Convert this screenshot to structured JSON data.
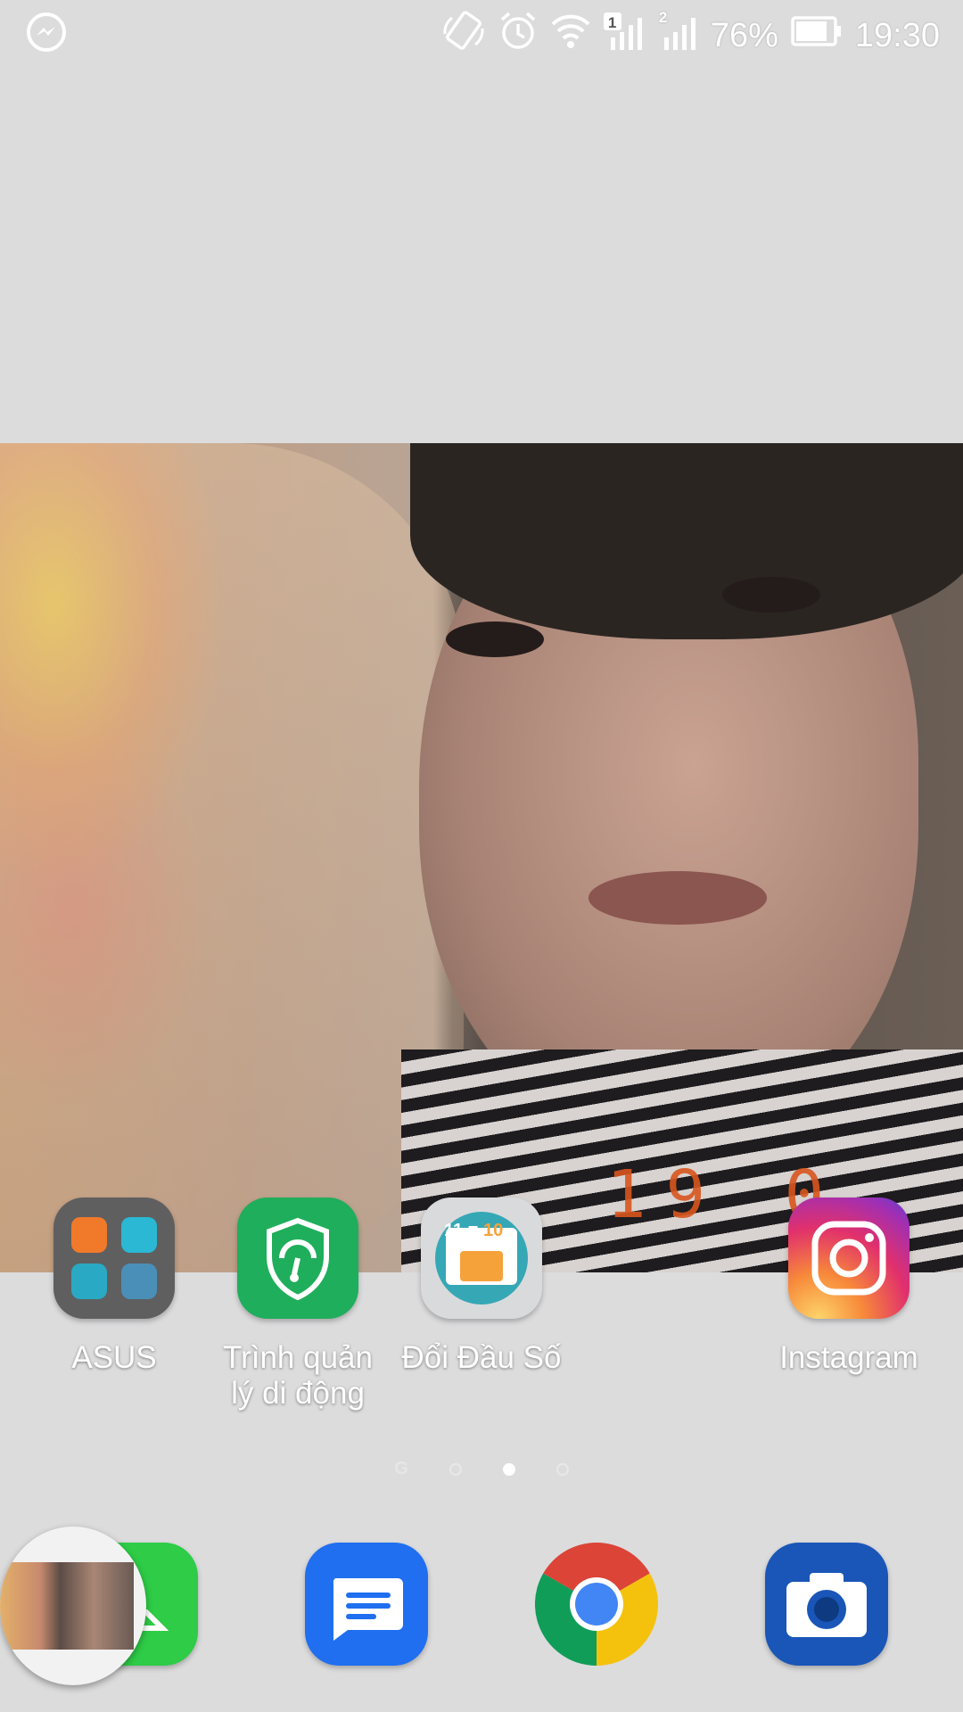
{
  "status_bar": {
    "left_icons": [
      "messenger-icon"
    ],
    "right_icons": [
      "auto-rotate-icon",
      "alarm-icon",
      "wifi-icon",
      "sim1-signal-icon",
      "sim2-signal-icon",
      "battery-icon"
    ],
    "sim1_badge": "1",
    "sim2_badge": "2",
    "battery_percent": "76%",
    "time": "19:30"
  },
  "wallpaper": {
    "date_stamp": "19 0"
  },
  "home_apps": [
    {
      "label": "ASUS",
      "icon": "asus-folder-icon"
    },
    {
      "label": "Trình quản lý di động",
      "icon": "mobile-manager-icon"
    },
    {
      "label": "Đổi Đầu Số",
      "icon": "sim-convert-icon",
      "badge_left": "11",
      "badge_mid": "=",
      "badge_right": "10"
    },
    {
      "label": "Instagram",
      "icon": "instagram-icon"
    }
  ],
  "page_indicator": {
    "google_glyph": "G",
    "pages": 3,
    "active_page": 2
  },
  "dock": [
    {
      "name": "phone",
      "icon": "phone-icon"
    },
    {
      "name": "messages",
      "icon": "messages-icon"
    },
    {
      "name": "chrome",
      "icon": "chrome-icon"
    },
    {
      "name": "camera",
      "icon": "camera-icon"
    }
  ],
  "colors": {
    "background": "#dcdcdd",
    "asus_folder": "#5f5f60",
    "mobile_manager": "#1fae5b",
    "sim_app": "#d9dadc",
    "phone": "#2ecc47",
    "messages": "#1f6ff0",
    "camera": "#1a56b8"
  }
}
